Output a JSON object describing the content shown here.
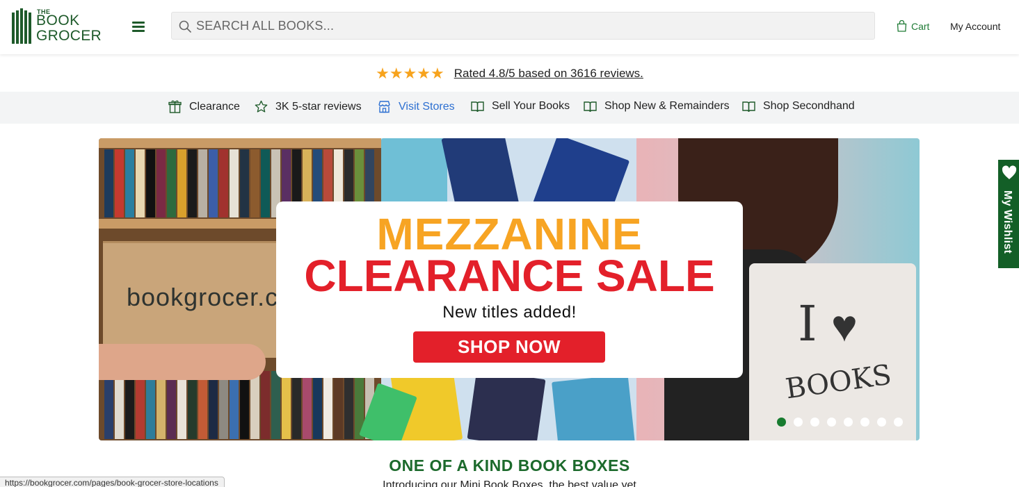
{
  "header": {
    "logo": {
      "the": "THE",
      "book": "BOOK",
      "grocer": "GROCER"
    },
    "search_placeholder": "SEARCH ALL BOOKS...",
    "cart_label": "Cart",
    "account_label": "My Account",
    "brand_color": "#1e5a2a"
  },
  "rating": {
    "stars": "★★★★★",
    "text": "Rated 4.8/5 based on 3616 reviews.",
    "star_color": "#f7a31d"
  },
  "nav": {
    "items": [
      {
        "label": "Clearance",
        "icon": "gift-icon"
      },
      {
        "label": "3K 5-star reviews",
        "icon": "star-icon"
      },
      {
        "label": "Visit Stores",
        "icon": "store-icon"
      },
      {
        "label": "Sell Your Books",
        "icon": "book-icon"
      },
      {
        "label": "Shop New & Remainders",
        "icon": "book-icon"
      },
      {
        "label": "Shop Secondhand",
        "icon": "book-icon"
      }
    ],
    "active_color": "#2c6fd1"
  },
  "banner": {
    "box_text": "bookgrocer.com",
    "headline_1": "MEZZANINE",
    "headline_2": "CLEARANCE SALE",
    "subline": "New titles added!",
    "cta": "SHOP NOW",
    "tote_i": "I",
    "tote_books": "BOOKS",
    "slide_count": 8,
    "active_slide": 1,
    "headline_1_color": "#f7a423",
    "headline_2_color": "#e3202a"
  },
  "wishlist": {
    "label": "My Wishlist"
  },
  "section": {
    "title": "ONE OF A KIND BOOK BOXES",
    "subtitle": "Introducing our Mini Book Boxes, the best value yet"
  },
  "statusbar": {
    "url": "https://bookgrocer.com/pages/book-grocer-store-locations"
  }
}
